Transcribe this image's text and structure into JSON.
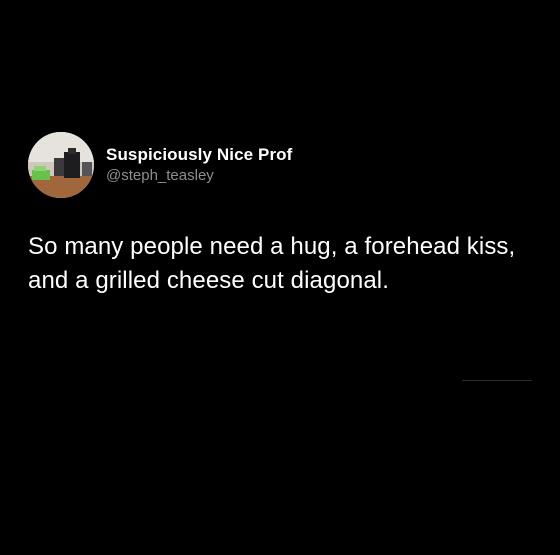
{
  "tweet": {
    "author": {
      "display_name": "Suspiciously Nice Prof",
      "handle": "@steph_teasley",
      "avatar_icon": "profile-photo-avatar"
    },
    "text": "So many people need a hug, a forehead kiss, and a grilled cheese cut diagonal."
  },
  "colors": {
    "background": "#000000",
    "text": "#ffffff",
    "handle": "#8b8f94"
  }
}
